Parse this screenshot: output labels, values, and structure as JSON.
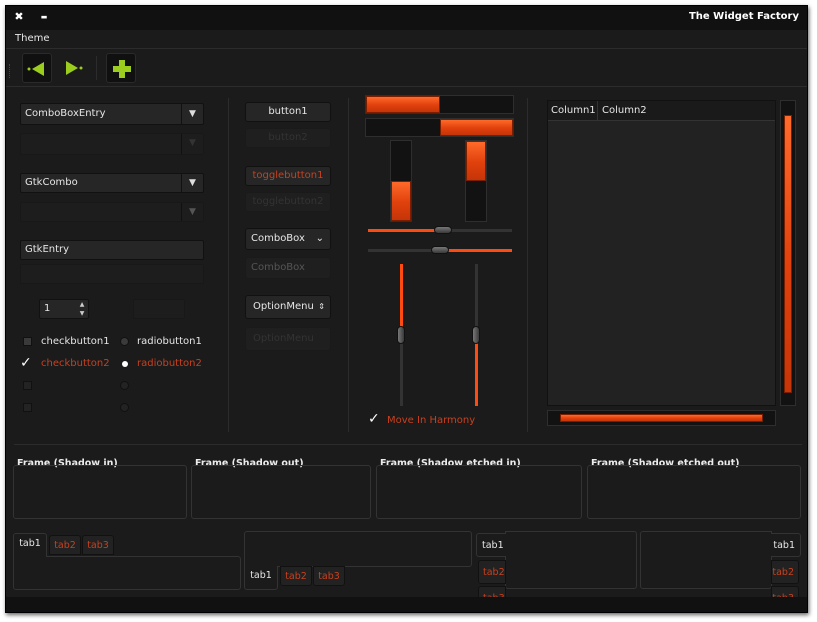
{
  "window": {
    "title": "The Widget Factory",
    "close_glyph": "✖",
    "minimize_glyph": "▬"
  },
  "menubar": {
    "theme": "Theme"
  },
  "toolbar": {
    "back_icon": "back-arrow-icon",
    "forward_icon": "forward-arrow-icon",
    "add_icon": "plus-icon"
  },
  "col1": {
    "combo_entry": "ComboBoxEntry",
    "gtk_combo": "GtkCombo",
    "entry": "GtkEntry",
    "spin_value": "1",
    "check1": "checkbutton1",
    "check2": "checkbutton2",
    "radio1": "radiobutton1",
    "radio2": "radiobutton2"
  },
  "col2": {
    "button1": "button1",
    "button2": "button2",
    "toggle1": "togglebutton1",
    "toggle2": "togglebutton2",
    "combobox": "ComboBox",
    "combobox_dis": "ComboBox",
    "optionmenu": "OptionMenu",
    "optionmenu_dis": "OptionMenu"
  },
  "col3": {
    "move_in_harmony": "Move In Harmony",
    "progress": {
      "h1": 0.5,
      "h2": 0.5,
      "v1": 0.5,
      "v2": 0.5
    },
    "hscale1": 0.52,
    "hscale2": 0.5,
    "vscale1": 0.5,
    "vscale2": 0.5
  },
  "treeview": {
    "columns": [
      "Column1",
      "Column2"
    ]
  },
  "frames": {
    "shadow_in": "Frame (Shadow in)",
    "shadow_out": "Frame (Shadow out)",
    "etched_in": "Frame (Shadow etched in)",
    "etched_out": "Frame (Shadow etched out)"
  },
  "tabs": [
    "tab1",
    "tab2",
    "tab3"
  ],
  "colors": {
    "accent": "#ff4a12",
    "bg": "#1b1b1b",
    "text_red": "#c8401e",
    "toolbar_icon": "#9acd1e"
  }
}
